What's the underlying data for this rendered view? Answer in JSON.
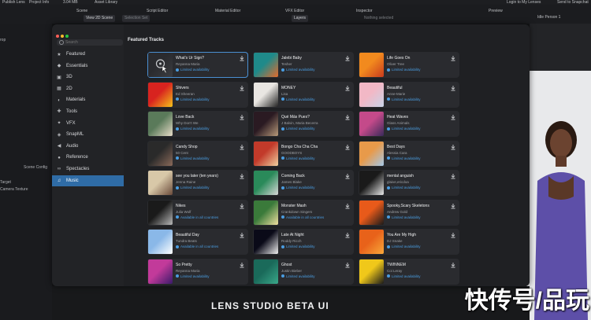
{
  "app": {
    "topbar": {
      "publish_label": "Publish Lens",
      "project_info": "Project Info",
      "size": "3.04 MB",
      "asset_library": "Asset Library",
      "login": "Login to My Lenses",
      "send": "Send to Snapchat"
    },
    "panels": {
      "scene": "Scene",
      "script_editor": "Script Editor",
      "material_editor": "Material Editor",
      "vfx_editor": "VFX Editor",
      "inspector": "Inspector",
      "preview": "Preview",
      "view_2d": "View 2D Scene",
      "selection_set": "Selection Set",
      "layers": "Layers",
      "nothing_selected": "Nothing selected",
      "idle_person": "Idle Person 1",
      "scene_config": "Scene Config",
      "left_item1": "Target",
      "left_item2": "Camera Texture",
      "left_item3": "rop"
    },
    "bottom_title": "LENS STUDIO BETA UI",
    "watermark": "快传号/品玩"
  },
  "modal": {
    "search_placeholder": "Search",
    "section_title": "Featured Tracks",
    "availability_label": "Limited availability",
    "sidebar": [
      {
        "label": "Featured",
        "icon": "star-icon"
      },
      {
        "label": "Essentials",
        "icon": "cube-icon"
      },
      {
        "label": "3D",
        "icon": "cube-3d-icon"
      },
      {
        "label": "2D",
        "icon": "image-icon"
      },
      {
        "label": "Materials",
        "icon": "materials-icon"
      },
      {
        "label": "Tools",
        "icon": "tools-icon"
      },
      {
        "label": "VFX",
        "icon": "sparkle-icon"
      },
      {
        "label": "SnapML",
        "icon": "ml-icon"
      },
      {
        "label": "Audio",
        "icon": "speaker-icon"
      },
      {
        "label": "Reference",
        "icon": "reference-icon"
      },
      {
        "label": "Spectacles",
        "icon": "spectacles-icon"
      },
      {
        "label": "Music",
        "icon": "music-icon",
        "active": true
      }
    ],
    "tracks": [
      {
        "title": "What's Ur Sign?",
        "artist": "Reyanna Maria",
        "availability": "Limited availability",
        "selected": true
      },
      {
        "title": "Jalebi Baby",
        "artist": "Tesher",
        "availability": "Limited availability"
      },
      {
        "title": "Life Goes On",
        "artist": "Oliver Tree",
        "availability": "Limited availability"
      },
      {
        "title": "Shivers",
        "artist": "Ed Sheeran",
        "availability": "Limited availability"
      },
      {
        "title": "MONEY",
        "artist": "Lisa",
        "availability": "Limited availability"
      },
      {
        "title": "Beautiful",
        "artist": "Anne-Marie",
        "availability": "Limited availability"
      },
      {
        "title": "Love Back",
        "artist": "Why Don't We",
        "availability": "Limited availability"
      },
      {
        "title": "Qué Más Pues?",
        "artist": "J Balvin, Maria Becerra",
        "availability": "Limited availability"
      },
      {
        "title": "Heat Waves",
        "artist": "Glass Animals",
        "availability": "Limited availability"
      },
      {
        "title": "Candy Shop",
        "artist": "50 Cent",
        "availability": "Limited availability"
      },
      {
        "title": "Bongo Cha Cha Cha",
        "artist": "GOODBOYS",
        "availability": "Limited availability"
      },
      {
        "title": "Best Days",
        "artist": "Alessia Cara",
        "availability": "Limited availability"
      },
      {
        "title": "see you later (ten years)",
        "artist": "Jenna Raine",
        "availability": "Limited availability"
      },
      {
        "title": "Coming Back",
        "artist": "James Blake",
        "availability": "Limited availability"
      },
      {
        "title": "mental anguish",
        "artist": "glaive,ericdoa",
        "availability": "Limited availability"
      },
      {
        "title": "Nikes",
        "artist": "Julia Wolf",
        "availability": "Available in all countries"
      },
      {
        "title": "Monster Mash",
        "artist": "Crankdown Singers",
        "availability": "Available in all countries"
      },
      {
        "title": "Spooky,Scary Skeletons",
        "artist": "Andrew Gold",
        "availability": "Limited availability"
      },
      {
        "title": "Beautiful Day",
        "artist": "Tundra Beats",
        "availability": "Available in all countries"
      },
      {
        "title": "Late At Night",
        "artist": "Roddy Ricch",
        "availability": "Limited availability"
      },
      {
        "title": "You Are My High",
        "artist": "DJ Snake",
        "availability": "Limited availability"
      },
      {
        "title": "So Pretty",
        "artist": "Reyanna Maria",
        "availability": "Limited availability"
      },
      {
        "title": "Ghost",
        "artist": "Justin Bieber",
        "availability": "Limited availability"
      },
      {
        "title": "TWINNEM",
        "artist": "Coi Leray",
        "availability": "Limited availability"
      }
    ]
  },
  "colors": {
    "accent": "#2f6ca6",
    "availability": "#4a9ce0",
    "modal_bg": "#222326",
    "card_bg": "#2a2b2f"
  }
}
